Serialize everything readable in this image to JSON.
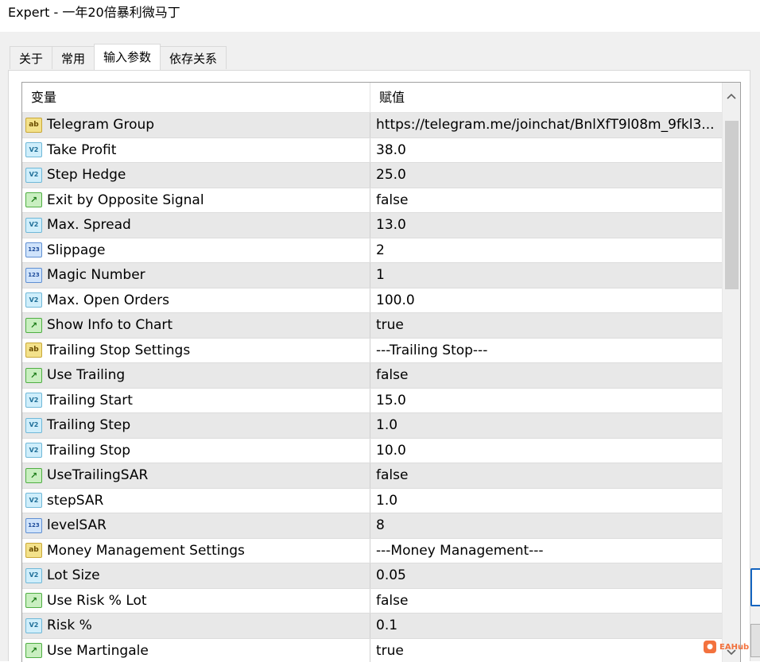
{
  "window": {
    "title": "Expert - 一年20倍暴利微马丁"
  },
  "tabs": [
    {
      "label": "关于",
      "active": false
    },
    {
      "label": "常用",
      "active": false
    },
    {
      "label": "输入参数",
      "active": true
    },
    {
      "label": "依存关系",
      "active": false
    }
  ],
  "grid": {
    "headers": {
      "variable": "变量",
      "value": "赋值"
    },
    "rows": [
      {
        "type": "string",
        "icon": "string-icon",
        "name": "Telegram Group",
        "value": "https://telegram.me/joinchat/BnlXfT9l08m_9fkl3..."
      },
      {
        "type": "double",
        "icon": "double-icon",
        "name": "Take Profit",
        "value": "38.0"
      },
      {
        "type": "double",
        "icon": "double-icon",
        "name": "Step Hedge",
        "value": "25.0"
      },
      {
        "type": "bool",
        "icon": "bool-icon",
        "name": "Exit by Opposite Signal",
        "value": "false"
      },
      {
        "type": "double",
        "icon": "double-icon",
        "name": "Max. Spread",
        "value": "13.0"
      },
      {
        "type": "int",
        "icon": "int-icon",
        "name": "Slippage",
        "value": "2"
      },
      {
        "type": "int",
        "icon": "int-icon",
        "name": "Magic Number",
        "value": "1"
      },
      {
        "type": "double",
        "icon": "double-icon",
        "name": "Max. Open Orders",
        "value": "100.0"
      },
      {
        "type": "bool",
        "icon": "bool-icon",
        "name": "Show Info to Chart",
        "value": "true"
      },
      {
        "type": "string",
        "icon": "string-icon",
        "name": "Trailing Stop Settings",
        "value": "---Trailing Stop---"
      },
      {
        "type": "bool",
        "icon": "bool-icon",
        "name": "Use Trailing",
        "value": "false"
      },
      {
        "type": "double",
        "icon": "double-icon",
        "name": "Trailing Start",
        "value": "15.0"
      },
      {
        "type": "double",
        "icon": "double-icon",
        "name": "Trailing Step",
        "value": "1.0"
      },
      {
        "type": "double",
        "icon": "double-icon",
        "name": "Trailing Stop",
        "value": "10.0"
      },
      {
        "type": "bool",
        "icon": "bool-icon",
        "name": "UseTrailingSAR",
        "value": "false"
      },
      {
        "type": "double",
        "icon": "double-icon",
        "name": "stepSAR",
        "value": "1.0"
      },
      {
        "type": "int",
        "icon": "int-icon",
        "name": "levelSAR",
        "value": "8"
      },
      {
        "type": "string",
        "icon": "string-icon",
        "name": "Money Management Settings",
        "value": "---Money Management---"
      },
      {
        "type": "double",
        "icon": "double-icon",
        "name": "Lot Size",
        "value": "0.05"
      },
      {
        "type": "bool",
        "icon": "bool-icon",
        "name": "Use Risk % Lot",
        "value": "false"
      },
      {
        "type": "double",
        "icon": "double-icon",
        "name": "Risk %",
        "value": "0.1"
      },
      {
        "type": "bool",
        "icon": "bool-icon",
        "name": "Use Martingale",
        "value": "true"
      }
    ]
  },
  "icon_glyphs": {
    "string": "ab",
    "double": "V2",
    "bool": "↗",
    "int": "123"
  },
  "scrollbar": {
    "up_icon": "chevron-up-icon",
    "down_icon": "chevron-down-icon"
  },
  "watermark": {
    "text": "EAHub"
  }
}
